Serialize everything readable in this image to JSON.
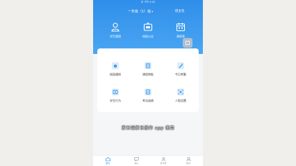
{
  "status_bar": {
    "text": "令 下午 4:23"
  },
  "header": {
    "class_select": "一年级（1）班",
    "top_link": "班主任",
    "actions": [
      {
        "label": "学生管理",
        "icon": "person-icon"
      },
      {
        "label": "校园公告",
        "icon": "notice-icon"
      },
      {
        "label": "课程表",
        "icon": "calendar-icon"
      }
    ]
  },
  "grid": [
    {
      "label": "校园通知",
      "icon": "bell-icon"
    },
    {
      "label": "课程审批",
      "icon": "approval-icon"
    },
    {
      "label": "今日考勤",
      "icon": "checkin-icon"
    },
    {
      "label": "学生行为",
      "icon": "behavior-icon"
    },
    {
      "label": "考试成绩",
      "icon": "score-icon"
    },
    {
      "label": "人脸设置",
      "icon": "face-icon"
    }
  ],
  "subtitle": "家长端家长操作 app 使用",
  "tabs": [
    {
      "label": "首页",
      "icon": "home-icon",
      "active": true
    },
    {
      "label": "消息",
      "icon": "message-icon",
      "active": false
    },
    {
      "label": "通讯录",
      "icon": "contacts-icon",
      "active": false
    },
    {
      "label": "我的",
      "icon": "profile-icon",
      "active": false
    }
  ],
  "colors": {
    "primary": "#2f8ee9",
    "icon_bg": "#dcecfb",
    "background": "#f0efec"
  }
}
